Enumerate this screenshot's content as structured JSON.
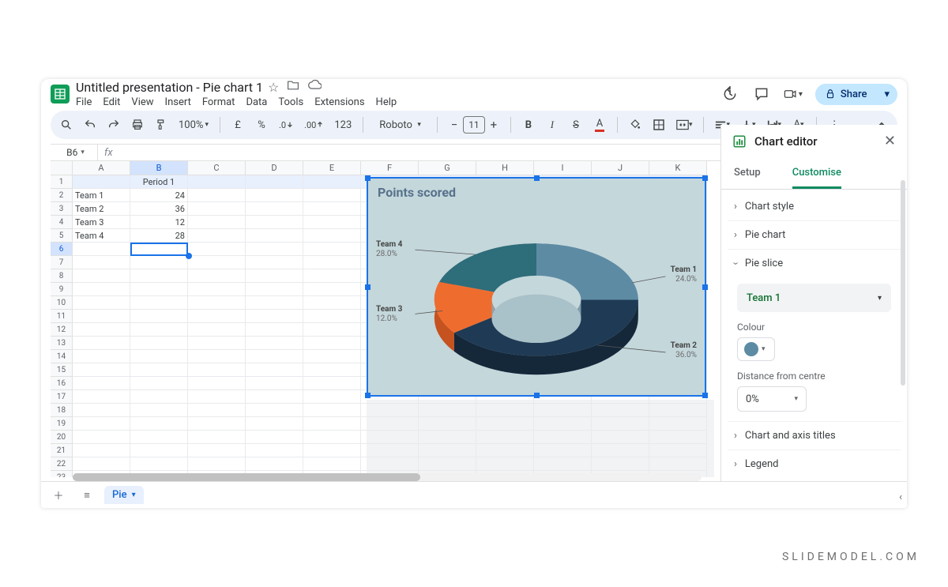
{
  "header": {
    "title": "Untitled presentation - Pie chart 1",
    "menu": [
      "File",
      "Edit",
      "View",
      "Insert",
      "Format",
      "Data",
      "Tools",
      "Extensions",
      "Help"
    ],
    "share": "Share"
  },
  "toolbar": {
    "zoom": "100%",
    "currency": "£",
    "percent": "%",
    "decDec": ".0",
    "incDec": ".00",
    "numfmt": "123",
    "font": "Roboto",
    "fontsize": "11"
  },
  "namebox": "B6",
  "columns": [
    "A",
    "B",
    "C",
    "D",
    "E",
    "F",
    "G",
    "H",
    "I",
    "J",
    "K"
  ],
  "rows_count": 25,
  "data": {
    "B1": "Period 1",
    "A2": "Team 1",
    "B2": "24",
    "A3": "Team 2",
    "B3": "36",
    "A4": "Team 3",
    "B4": "12",
    "A5": "Team 4",
    "B5": "28"
  },
  "chart": {
    "title": "Points scored",
    "labels": {
      "t1": {
        "name": "Team 1",
        "pct": "24.0%"
      },
      "t2": {
        "name": "Team 2",
        "pct": "36.0%"
      },
      "t3": {
        "name": "Team 3",
        "pct": "12.0%"
      },
      "t4": {
        "name": "Team 4",
        "pct": "28.0%"
      }
    }
  },
  "editor": {
    "title": "Chart editor",
    "tabs": {
      "setup": "Setup",
      "customise": "Customise"
    },
    "sections": {
      "chart_style": "Chart style",
      "pie_chart": "Pie chart",
      "pie_slice": "Pie slice",
      "chart_axis_titles": "Chart and axis titles",
      "legend": "Legend"
    },
    "slice_select": "Team 1",
    "colour_label": "Colour",
    "distance_label": "Distance from centre",
    "distance_value": "0%"
  },
  "sheet_tab": "Pie",
  "watermark": "SLIDEMODEL.COM",
  "chart_data": {
    "type": "pie",
    "title": "Points scored",
    "categories": [
      "Team 1",
      "Team 2",
      "Team 3",
      "Team 4"
    ],
    "values": [
      24,
      36,
      12,
      28
    ],
    "percentages": [
      24.0,
      36.0,
      12.0,
      28.0
    ],
    "donut_hole": 0.45,
    "is_3d": true,
    "colors": {
      "Team 1": "#5e8ba4",
      "Team 2": "#1f3a54",
      "Team 3": "#ef6c2f",
      "Team 4": "#2e6d7a"
    }
  }
}
